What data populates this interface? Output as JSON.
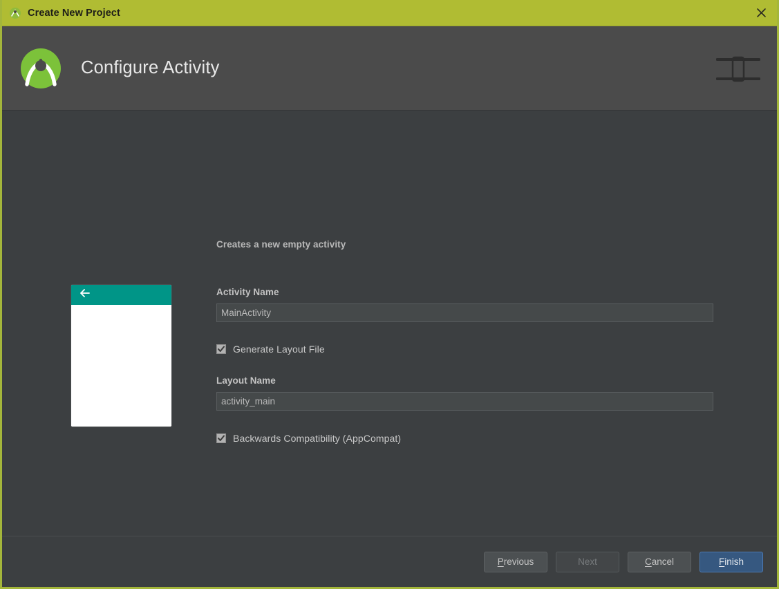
{
  "titlebar": {
    "title": "Create New Project",
    "icon": "android-studio-icon",
    "close_icon": "close-icon"
  },
  "header": {
    "title": "Configure Activity",
    "logo_icon": "android-studio-logo",
    "right_icon": "layout-distribute-icon",
    "accent_green": "#a4c439",
    "bg": "#4b4b4b"
  },
  "main": {
    "description": "Creates a new empty activity",
    "preview": {
      "name": "activity-preview-thumbnail",
      "appbar_color": "#009587",
      "body_color": "#ffffff",
      "back_icon": "arrow-left-icon"
    },
    "fields": {
      "activity_name": {
        "label": "Activity Name",
        "value": "MainActivity",
        "placeholder": "MainActivity"
      },
      "layout_name": {
        "label": "Layout Name",
        "value": "activity_main",
        "placeholder": "activity_main"
      }
    },
    "checkboxes": {
      "generate_layout": {
        "label": "Generate Layout File",
        "checked": true
      },
      "backwards_compat": {
        "label": "Backwards Compatibility (AppCompat)",
        "checked": true
      }
    }
  },
  "footer": {
    "buttons": [
      {
        "label": "Previous",
        "mnemonic": "P",
        "state": "enabled",
        "kind": "default"
      },
      {
        "label": "Next",
        "mnemonic": "",
        "state": "disabled",
        "kind": "default"
      },
      {
        "label": "Cancel",
        "mnemonic": "C",
        "state": "enabled",
        "kind": "default"
      },
      {
        "label": "Finish",
        "mnemonic": "F",
        "state": "enabled",
        "kind": "primary"
      }
    ],
    "primary_color": "#365880"
  }
}
